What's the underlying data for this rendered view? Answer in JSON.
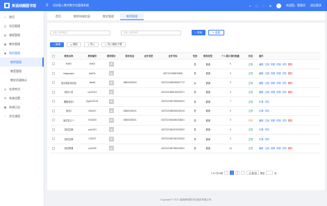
{
  "app": {
    "name": "英语线圈图书馆",
    "system": "培训收入教学数字化管理系统",
    "menu_toggle": "≡"
  },
  "topbar": {
    "icons": [
      "⌕",
      "⛶",
      "◌",
      "⊕"
    ],
    "user": "欢迎您，管理员",
    "logout": "退出登录"
  },
  "sidebar": {
    "items": [
      {
        "label": "首页",
        "icon": "⌂"
      },
      {
        "label": "学员管理",
        "icon": "◫"
      },
      {
        "label": "课程管理",
        "icon": "▤"
      },
      {
        "label": "教学管理",
        "icon": "▦"
      },
      {
        "label": "角色管理",
        "icon": "◉",
        "active": true
      },
      {
        "label": "教师管理",
        "icon": "◇",
        "sub": true,
        "active": true
      },
      {
        "label": "教室管理",
        "icon": "",
        "sub": true
      },
      {
        "label": "教学资源统计",
        "icon": "",
        "sub": true
      },
      {
        "label": "在线考试",
        "icon": "◎"
      },
      {
        "label": "系统设置",
        "icon": "⚙"
      },
      {
        "label": "系统日志",
        "icon": "▣"
      },
      {
        "label": "学生课程",
        "icon": "◔"
      }
    ]
  },
  "tabs": [
    {
      "label": "首页"
    },
    {
      "label": "教师排课信息"
    },
    {
      "label": "教学管理"
    },
    {
      "label": "教师管理",
      "active": true
    }
  ],
  "search": {
    "name_placeholder": "请输入教师姓名",
    "subject_placeholder": "请输入教师学科",
    "search_btn": "查询",
    "reset_btn": "重置"
  },
  "toolbar": {
    "add": "新增",
    "delete": "删除",
    "import": "导入",
    "download": "导入模板下载"
  },
  "table": {
    "headers": [
      "教师名称",
      "教师编号",
      "教师照片",
      "联系电话",
      "证件类型",
      "证件号码",
      "性别",
      "教师类型",
      "个人累计课时数量",
      "状态",
      "操作"
    ],
    "rows": [
      {
        "name": "lwd01",
        "code": "lwd01",
        "phone": "",
        "idtype": "",
        "idno": "",
        "gender": "男",
        "type": "普通",
        "hours": "0",
        "status": "正常",
        "actions": [
          "编辑",
          "注销",
          "排课",
          "停课",
          "详情",
          "删除"
        ]
      },
      {
        "name": "nanguayue",
        "code": "lwd111",
        "phone": "",
        "idtype": "",
        "idno": "4307221989030800",
        "gender": "男",
        "type": "普通",
        "hours": "0",
        "status": "正常",
        "actions": [
          "编辑",
          "注销",
          "排课",
          "停课",
          "详情",
          "删除"
        ]
      },
      {
        "name": "显示绑定测试出",
        "code": "fsdsdl",
        "phone": "18800000000",
        "idtype": "",
        "idno": "4307221989030807772",
        "gender": "女",
        "type": "普通",
        "hours": "0",
        "status": "正常",
        "actions": [
          "编辑",
          "注销",
          "排课",
          "停课",
          "详情",
          "删除"
        ]
      },
      {
        "name": "测试人员",
        "code": "uw22312",
        "phone": "",
        "idtype": "",
        "idno": "4307221989120520071",
        "gender": "男",
        "type": "普通",
        "hours": "0",
        "status": "正常",
        "actions": [
          "编辑",
          "注销",
          "排课",
          "停课",
          "详情",
          "删除"
        ]
      },
      {
        "name": "课程测试1",
        "code": "jhgh123123",
        "phone": "",
        "idtype": "",
        "idno": "4307221987030500022",
        "gender": "男",
        "type": "普通",
        "hours": "7",
        "status": "正常",
        "actions": [
          "补课",
          "详情"
        ]
      },
      {
        "name": "测试2",
        "code": "SB1007",
        "phone": "15800000021",
        "idtype": "",
        "idno": "4307221989020500015",
        "gender": "男",
        "type": "普通",
        "hours": "0",
        "status": "正常",
        "actions": [
          "补课",
          "详情"
        ]
      },
      {
        "name": "测试名几个",
        "code": "HU0225",
        "phone": "15800000021",
        "idtype": "",
        "idno": "4307221984040318521",
        "gender": "男",
        "type": "普通",
        "hours": "0",
        "status": "停用",
        "actions": [
          "编辑",
          "注销",
          "排课",
          "停课",
          "详情",
          "删除"
        ]
      },
      {
        "name": "测试注销",
        "code": "ced1031",
        "phone": "",
        "idtype": "",
        "idno": "4307221984070520022",
        "gender": "男",
        "type": "普通",
        "hours": "0",
        "status": "正常",
        "actions": [
          "补课",
          "详情"
        ]
      },
      {
        "name": "测试注销",
        "code": "C30207",
        "phone": "",
        "idtype": "",
        "idno": "4307221987040320032",
        "gender": "男",
        "type": "普通",
        "hours": "0",
        "status": "正常",
        "actions": [
          "补课",
          "详情"
        ]
      },
      {
        "name": "测试带课",
        "code": "uw2009",
        "phone": "",
        "idtype": "",
        "idno": "4307221987060020061",
        "gender": "男",
        "type": "普通",
        "hours": "13",
        "status": "正常",
        "actions": [
          "编辑",
          "注销",
          "排课",
          "停课",
          "详情",
          "删除"
        ]
      }
    ]
  },
  "pager": {
    "range": "1-10 共14条",
    "pages": [
      "‹",
      "1",
      "2",
      "›"
    ],
    "page_size": "10 条/页",
    "goto": "跳至",
    "page_suffix": "页"
  },
  "footer": {
    "text": "Copyright © 2022 湖南教育数字化服务有限公司"
  }
}
